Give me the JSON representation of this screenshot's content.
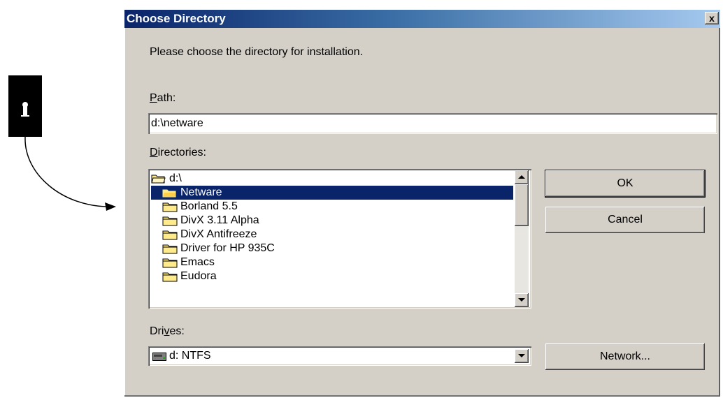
{
  "dialog": {
    "title": "Choose Directory",
    "close_label": "x",
    "prompt": "Please choose the directory for installation."
  },
  "path": {
    "label_accel": "P",
    "label_rest": "ath:",
    "value": "d:\\netware"
  },
  "directories": {
    "label_accel": "D",
    "label_rest": "irectories:",
    "root": "d:\\",
    "items": [
      {
        "label": "Netware",
        "selected": true,
        "icon": "folder-open-icon"
      },
      {
        "label": "Borland 5.5",
        "selected": false,
        "icon": "folder-icon"
      },
      {
        "label": "DivX 3.11 Alpha",
        "selected": false,
        "icon": "folder-icon"
      },
      {
        "label": "DivX Antifreeze",
        "selected": false,
        "icon": "folder-icon"
      },
      {
        "label": "Driver for HP 935C",
        "selected": false,
        "icon": "folder-icon"
      },
      {
        "label": "Emacs",
        "selected": false,
        "icon": "folder-icon"
      },
      {
        "label": "Eudora",
        "selected": false,
        "icon": "folder-icon"
      }
    ]
  },
  "drives": {
    "label_pre": "Dri",
    "label_accel": "v",
    "label_rest": "es:",
    "selected": "d: NTFS",
    "icon": "drive-icon"
  },
  "buttons": {
    "ok": "OK",
    "cancel": "Cancel",
    "network": "Network..."
  },
  "colors": {
    "face": "#d4d0c8",
    "selection": "#0a246a",
    "titlebar_start": "#0a246a",
    "titlebar_end": "#a6caf0"
  }
}
